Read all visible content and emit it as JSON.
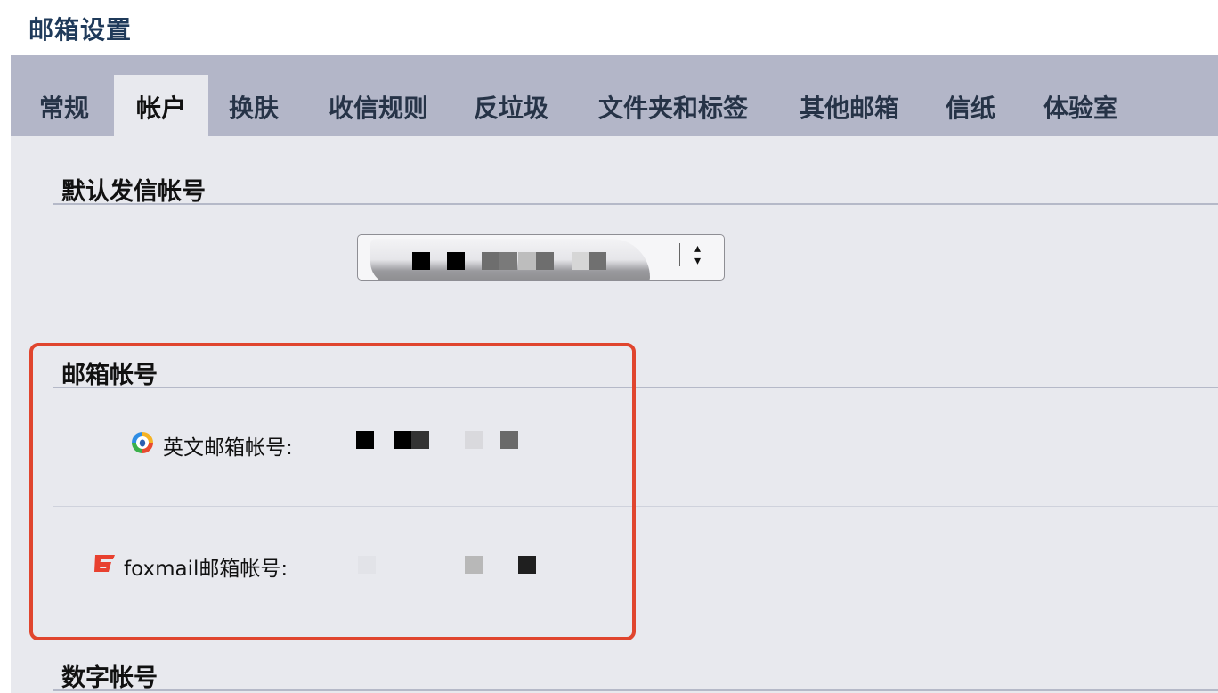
{
  "page": {
    "title": "邮箱设置"
  },
  "tabs": [
    {
      "label": "常规",
      "active": false
    },
    {
      "label": "帐户",
      "active": true
    },
    {
      "label": "换肤",
      "active": false
    },
    {
      "label": "收信规则",
      "active": false
    },
    {
      "label": "反垃圾",
      "active": false
    },
    {
      "label": "文件夹和标签",
      "active": false
    },
    {
      "label": "其他邮箱",
      "active": false
    },
    {
      "label": "信纸",
      "active": false
    },
    {
      "label": "体验室",
      "active": false
    }
  ],
  "sections": {
    "default_sender": {
      "title": "默认发信帐号",
      "select_value": ""
    },
    "mailbox_accounts": {
      "title": "邮箱帐号",
      "english_label": "英文邮箱帐号:",
      "english_icon": "qq-mail-icon",
      "foxmail_label": "foxmail邮箱帐号:",
      "foxmail_icon": "foxmail-icon"
    },
    "numeric_account": {
      "title": "数字帐号"
    }
  },
  "colors": {
    "title": "#1f3a5a",
    "tabbar": "#b3b6c8",
    "panel": "#e8e9ee",
    "highlight": "#e0452e"
  }
}
